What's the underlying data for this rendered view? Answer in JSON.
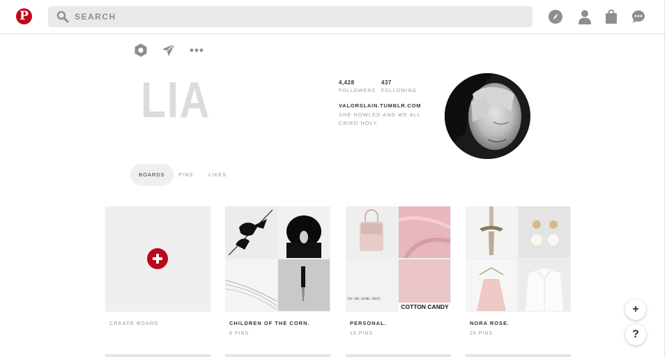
{
  "header": {
    "logo_letter": "P",
    "search_placeholder": "SEARCH",
    "icons": [
      "compass-icon",
      "profile-icon",
      "bag-icon",
      "messages-icon"
    ]
  },
  "profile": {
    "name": "LIA",
    "followers_count": "4,428",
    "followers_label": "FOLLOWERS",
    "following_count": "437",
    "following_label": "FOLLOWING",
    "website": "VALORSLAIN.TUMBLR.COM",
    "bio": "SHE HOWLED AND WE ALL CRIED HOLY.",
    "actions": [
      "settings-icon",
      "send-icon",
      "more-icon"
    ]
  },
  "tabs": [
    {
      "label": "BOARDS",
      "active": true
    },
    {
      "label": "PINS",
      "active": false
    },
    {
      "label": "LIKES",
      "active": false
    }
  ],
  "boards": [
    {
      "title": "CREATE BOARD",
      "count": ""
    },
    {
      "title": "CHILDREN OF THE CORN.",
      "count": "8 PINS"
    },
    {
      "title": "PERSONAL.",
      "count": "10 PINS",
      "overlay_text": "COTTON CANDY",
      "small_text": "YOU ARE DOING GREAT."
    },
    {
      "title": "NORA ROSE.",
      "count": "26 PINS"
    }
  ],
  "floating": {
    "add": "+",
    "help": "?"
  },
  "colors": {
    "brand": "#bd081c",
    "search_bg": "#e9e9e9"
  }
}
